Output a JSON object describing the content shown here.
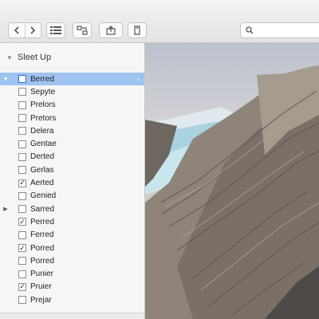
{
  "toolbar": {
    "back_icon": "chevron-left-icon",
    "forward_icon": "chevron-right-icon",
    "view_icon": "list-view-icon",
    "arrange_icon": "arrange-icon",
    "share_icon": "share-icon",
    "tag_icon": "tag-icon",
    "search": {
      "icon": "search-icon",
      "value": "",
      "placeholder": ""
    }
  },
  "sidebar": {
    "header": "Sleet Up",
    "selected_color": "#9ec3ef",
    "items": [
      {
        "label": "Berred",
        "checked": false,
        "selected": true,
        "disclosure": "expanded"
      },
      {
        "label": "Sepyte",
        "checked": false,
        "selected": false,
        "disclosure": "none"
      },
      {
        "label": "Prelors",
        "checked": false,
        "selected": false,
        "disclosure": "none"
      },
      {
        "label": "Pretors",
        "checked": false,
        "selected": false,
        "disclosure": "none"
      },
      {
        "label": "Delera",
        "checked": false,
        "selected": false,
        "disclosure": "none"
      },
      {
        "label": "Gentae",
        "checked": false,
        "selected": false,
        "disclosure": "none"
      },
      {
        "label": "Derted",
        "checked": false,
        "selected": false,
        "disclosure": "none"
      },
      {
        "label": "Gerlas",
        "checked": false,
        "selected": false,
        "disclosure": "none"
      },
      {
        "label": "Aerted",
        "checked": true,
        "selected": false,
        "disclosure": "none"
      },
      {
        "label": "Genied",
        "checked": false,
        "selected": false,
        "disclosure": "none"
      },
      {
        "label": "Sarred",
        "checked": false,
        "selected": false,
        "disclosure": "collapsed"
      },
      {
        "label": "Perred",
        "checked": true,
        "selected": false,
        "disclosure": "none"
      },
      {
        "label": "Ferred",
        "checked": false,
        "selected": false,
        "disclosure": "none"
      },
      {
        "label": "Porred",
        "checked": true,
        "selected": false,
        "disclosure": "none"
      },
      {
        "label": "Porred",
        "checked": false,
        "selected": false,
        "disclosure": "none"
      },
      {
        "label": "Punier",
        "checked": false,
        "selected": false,
        "disclosure": "none"
      },
      {
        "label": "Pruier",
        "checked": true,
        "selected": false,
        "disclosure": "none"
      },
      {
        "label": "Prejar",
        "checked": false,
        "selected": false,
        "disclosure": "none"
      }
    ]
  },
  "preview": {
    "subject": "rocky-mountain-photo"
  }
}
